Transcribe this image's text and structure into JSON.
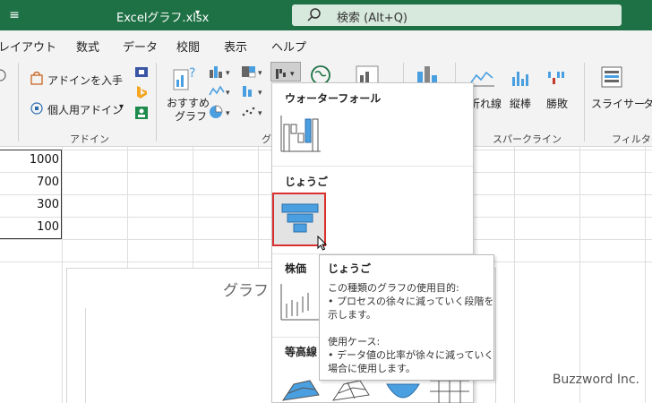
{
  "titlebar": {
    "filename": "Excelグラフ.xlsx",
    "search_text": "検索 (Alt+Q)"
  },
  "tabs": [
    "レイアウト",
    "数式",
    "データ",
    "校閲",
    "表示",
    "ヘルプ"
  ],
  "ribbon": {
    "addin_get": "アドインを入手",
    "addin_personal": "個人用アドイン",
    "addin_group": "アドイン",
    "recommended_line1": "おすすめ",
    "recommended_line2": "グラフ",
    "chart_group_partial": "グ",
    "sparkline_line": "折れ線",
    "sparkline_bar": "縦棒",
    "sparkline_winloss": "勝敗",
    "sparkline_group": "スパークライン",
    "slicer": "スライサー",
    "timeline_partial": "タ",
    "filter_group": "フィルター"
  },
  "cells": [
    "1000",
    "700",
    "300",
    "100"
  ],
  "chart": {
    "title_partial": "グラフ"
  },
  "gallery": {
    "waterfall": "ウォーターフォール",
    "funnel": "じょうご",
    "stock": "株価",
    "contour": "等高線"
  },
  "tooltip": {
    "title": "じょうご",
    "line1": "この種類のグラフの使用目的:",
    "line2": "• プロセスの徐々に減っていく段階を",
    "line3": "示します。",
    "line4": "使用ケース:",
    "line5": "• データ値の比率が徐々に減っていく",
    "line6": "場合に使用します。"
  },
  "watermark": "Buzzword Inc.",
  "colors": {
    "titlebar": "#1e7145",
    "accent_blue": "#4a9fe0",
    "highlight": "#d9302f"
  }
}
